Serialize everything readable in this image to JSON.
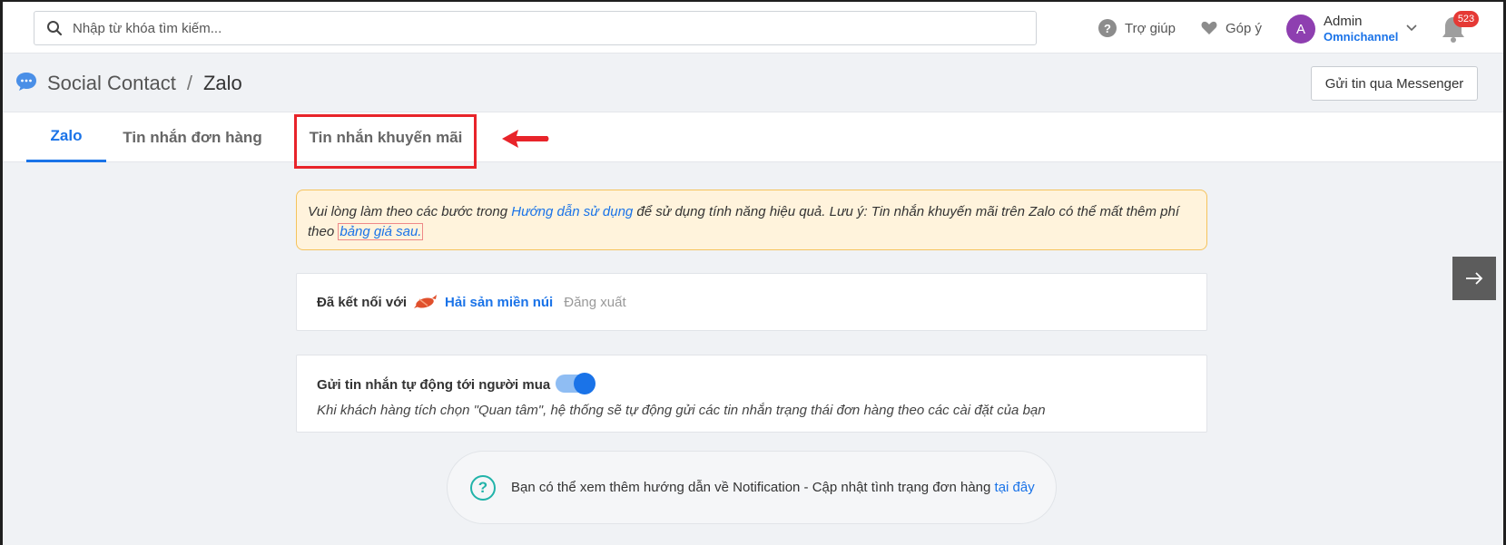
{
  "topbar": {
    "search_placeholder": "Nhập từ khóa tìm kiếm...",
    "help_label": "Trợ giúp",
    "feedback_label": "Góp ý",
    "user": {
      "initial": "A",
      "name": "Admin",
      "channel": "Omnichannel"
    },
    "notifications_count": "523"
  },
  "breadcrumb": {
    "root": "Social Contact",
    "separator": "/",
    "current": "Zalo"
  },
  "header_button": "Gửi tin qua Messenger",
  "tabs": [
    {
      "label": "Zalo",
      "active": true
    },
    {
      "label": "Tin nhắn đơn hàng",
      "active": false
    },
    {
      "label": "Tin nhắn khuyến mãi",
      "active": false
    }
  ],
  "notice": {
    "text_before": "Vui lòng làm theo các bước trong ",
    "guide_link": "Hướng dẫn sử dụng",
    "text_middle": " để sử dụng tính năng hiệu quả. Lưu ý: Tin nhắn khuyến mãi trên Zalo có thể mất thêm phí theo ",
    "price_link": "bảng giá sau."
  },
  "connection": {
    "label": "Đã kết nối với",
    "shop_name": "Hải sản miền núi",
    "logout_label": "Đăng xuất"
  },
  "auto_message": {
    "label": "Gửi tin nhắn tự động tới người mua",
    "enabled": true,
    "description": "Khi khách hàng tích chọn \"Quan tâm\", hệ thống sẽ tự động gửi các tin nhắn trạng thái đơn hàng theo các cài đặt của bạn"
  },
  "info": {
    "text": "Bạn có thể xem thêm hướng dẫn về Notification - Cập nhật tình trạng đơn hàng ",
    "link": "tại đây"
  },
  "colors": {
    "accent": "#1a73e8",
    "highlight": "#e8242a",
    "notice_bg": "#fff3dc",
    "badge": "#e53935",
    "avatar": "#8e3fb0"
  }
}
